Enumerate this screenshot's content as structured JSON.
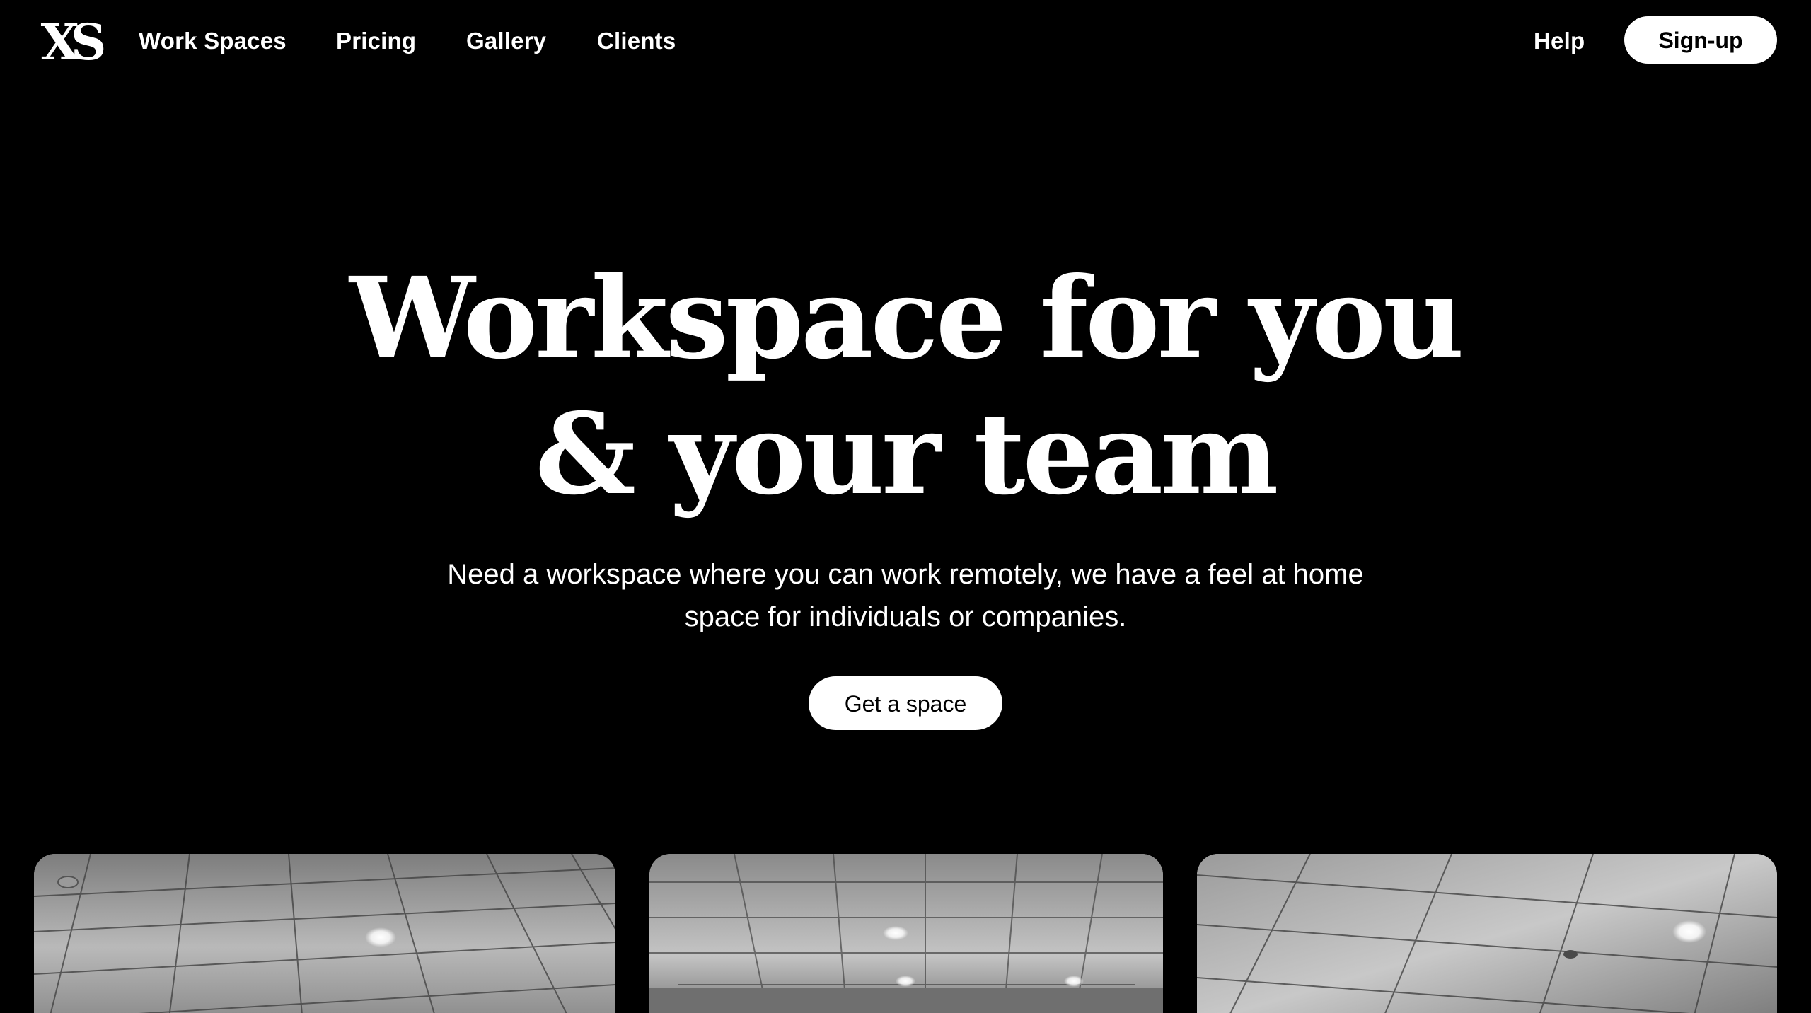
{
  "brand": {
    "logo_text": "XS"
  },
  "nav": {
    "items": [
      {
        "label": "Work Spaces"
      },
      {
        "label": "Pricing"
      },
      {
        "label": "Gallery"
      },
      {
        "label": "Clients"
      }
    ],
    "help_label": "Help",
    "signup_label": "Sign-up"
  },
  "hero": {
    "title_line1": "Workspace for you",
    "title_line2": "& your team",
    "subtitle_line1": "Need a workspace where you can work remotely, we have a feel at home",
    "subtitle_line2": "space for individuals or companies.",
    "cta_label": "Get a space"
  },
  "gallery": {
    "cards": [
      {
        "image": "office-ceiling-photo"
      },
      {
        "image": "office-ceiling-photo"
      },
      {
        "image": "office-ceiling-photo"
      }
    ]
  },
  "colors": {
    "background": "#000000",
    "text": "#ffffff",
    "button_bg": "#ffffff",
    "button_text": "#000000"
  }
}
